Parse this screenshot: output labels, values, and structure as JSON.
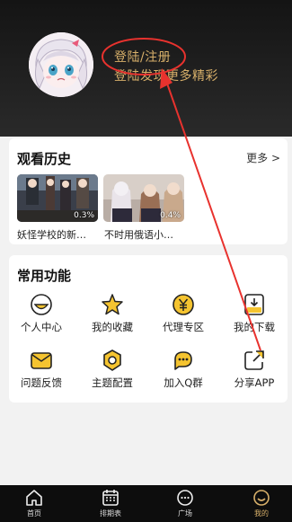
{
  "profile": {
    "login_title": "登陆/注册",
    "login_subtitle": "登陆发现更多精彩"
  },
  "history": {
    "title": "观看历史",
    "more": "更多 >",
    "items": [
      {
        "title": "妖怪学校的新…",
        "progress": "0.3%"
      },
      {
        "title": "不时用俄语小…",
        "progress": "0.4%"
      }
    ]
  },
  "features": {
    "title": "常用功能",
    "items": [
      {
        "label": "个人中心",
        "icon": "smile-face-icon"
      },
      {
        "label": "我的收藏",
        "icon": "star-icon"
      },
      {
        "label": "代理专区",
        "icon": "yen-coin-icon"
      },
      {
        "label": "我的下载",
        "icon": "download-icon"
      },
      {
        "label": "问题反馈",
        "icon": "mail-icon"
      },
      {
        "label": "主题配置",
        "icon": "theme-icon"
      },
      {
        "label": "加入Q群",
        "icon": "chat-bubble-icon"
      },
      {
        "label": "分享APP",
        "icon": "share-icon"
      }
    ]
  },
  "tabbar": {
    "items": [
      {
        "label": "首页",
        "icon": "home-icon"
      },
      {
        "label": "排期表",
        "icon": "calendar-icon"
      },
      {
        "label": "广场",
        "icon": "message-icon"
      },
      {
        "label": "我的",
        "icon": "smile-face-icon",
        "active": true
      }
    ]
  },
  "colors": {
    "accent": "#d8b06a",
    "icon_fill": "#f5c430",
    "annotation": "#e8322e"
  }
}
